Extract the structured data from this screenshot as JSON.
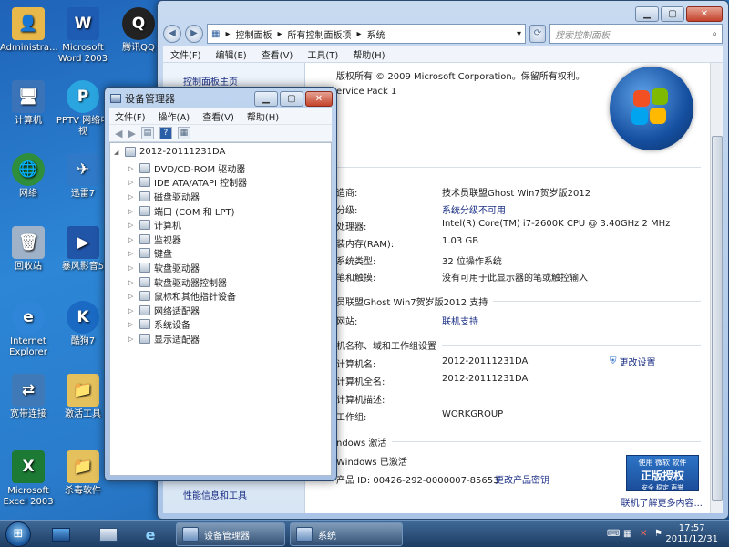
{
  "desktop": {
    "icons": [
      {
        "label": "Administra...",
        "icon": "user-folder-icon",
        "color": "#e8b84a"
      },
      {
        "label": "Microsoft Word 2003",
        "icon": "word-icon",
        "color": "#1e5bb3"
      },
      {
        "label": "腾讯QQ",
        "icon": "qq-penguin-icon",
        "color": "#222222"
      },
      {
        "label": "计算机",
        "icon": "computer-icon",
        "color": "#3a73b8"
      },
      {
        "label": "PPTV 网络电视",
        "icon": "pptv-icon",
        "color": "#2aa5e0"
      },
      {
        "label": "网络",
        "icon": "network-icon",
        "color": "#2f8e3b"
      },
      {
        "label": "迅雷7",
        "icon": "thunder-icon",
        "color": "#2f79c8"
      },
      {
        "label": "回收站",
        "icon": "recycle-bin-icon",
        "color": "#9fb2c7"
      },
      {
        "label": "暴风影音5",
        "icon": "baofeng-icon",
        "color": "#2055a8"
      },
      {
        "label": "Internet Explorer",
        "icon": "ie-icon",
        "color": "#2f86d8"
      },
      {
        "label": "酷狗7",
        "icon": "kugou-icon",
        "color": "#1a6ac4"
      },
      {
        "label": "宽带连接",
        "icon": "broadband-icon",
        "color": "#3f79b8"
      },
      {
        "label": "激活工具",
        "icon": "folder-icon",
        "color": "#e5c15d"
      },
      {
        "label": "Microsoft Excel 2003",
        "icon": "excel-icon",
        "color": "#1c7a34"
      },
      {
        "label": "杀毒软件",
        "icon": "folder-icon",
        "color": "#e5c15d"
      }
    ]
  },
  "system_window": {
    "address": [
      "控制面板",
      "所有控制面板项",
      "系统"
    ],
    "search_placeholder": "搜索控制面板",
    "menu": [
      "文件(F)",
      "编辑(E)",
      "查看(V)",
      "工具(T)",
      "帮助(H)"
    ],
    "left_top_link": "控制面板主页",
    "left_bottom_link": "性能信息和工具",
    "copyright": "版权所有 © 2009 Microsoft Corporation。保留所有权利。",
    "service_pack": "ervice Pack 1",
    "specs": [
      {
        "label": "造商:",
        "value": "技术员联盟Ghost Win7贺岁版2012",
        "link": false
      },
      {
        "label": "分级:",
        "value": "系统分级不可用",
        "link": true
      },
      {
        "label": "处理器:",
        "value": "Intel(R) Core(TM) i7-2600K CPU @ 3.40GHz   2 MHz",
        "link": false
      },
      {
        "label": "装内存(RAM):",
        "value": "1.03 GB",
        "link": false
      },
      {
        "label": "系统类型:",
        "value": "32 位操作系统",
        "link": false
      },
      {
        "label": "笔和触摸:",
        "value": "没有可用于此显示器的笔或触控输入",
        "link": false
      }
    ],
    "support_section": "员联盟Ghost Win7贺岁版2012 支持",
    "support_label": "网站:",
    "support_value": "联机支持",
    "computer_section": "机名称、域和工作组设置",
    "computer_rows": [
      {
        "label": "计算机名:",
        "value": "2012-20111231DA"
      },
      {
        "label": "计算机全名:",
        "value": "2012-20111231DA"
      },
      {
        "label": "计算机描述:",
        "value": ""
      },
      {
        "label": "工作组:",
        "value": "WORKGROUP"
      }
    ],
    "change_settings": "更改设置",
    "activation_section": "ndows 激活",
    "activation_status": "Windows 已激活",
    "product_id": "产品 ID: 00426-292-0000007-85653",
    "change_key": "更改产品密钥",
    "genuine_top": "使用 微软 软件",
    "genuine_main": "正版授权",
    "genuine_sub": "安全 稳定 声誉",
    "learn_more": "联机了解更多内容..."
  },
  "device_manager": {
    "title": "设备管理器",
    "menu": [
      "文件(F)",
      "操作(A)",
      "查看(V)",
      "帮助(H)"
    ],
    "root": "2012-20111231DA",
    "nodes": [
      "DVD/CD-ROM 驱动器",
      "IDE ATA/ATAPI 控制器",
      "磁盘驱动器",
      "端口 (COM 和 LPT)",
      "计算机",
      "监视器",
      "键盘",
      "软盘驱动器",
      "软盘驱动器控制器",
      "鼠标和其他指针设备",
      "网络适配器",
      "系统设备",
      "显示适配器"
    ]
  },
  "taskbar": {
    "tasks": [
      "设备管理器",
      "系统"
    ],
    "time": "17:57",
    "date": "2011/12/31"
  }
}
